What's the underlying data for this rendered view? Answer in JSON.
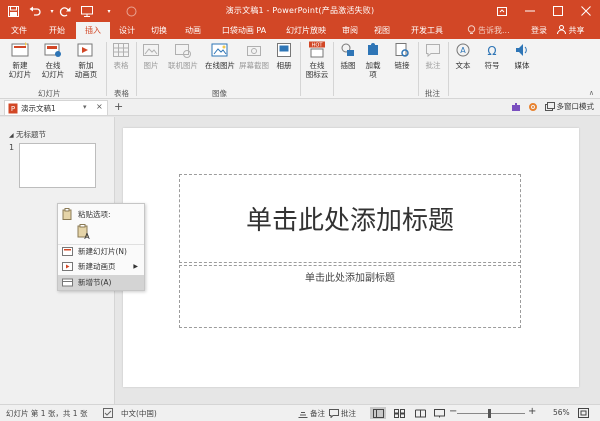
{
  "title_bar": {
    "title": "演示文稿1 - PowerPoint(产品激活失败)",
    "controls": [
      "minimize-icon",
      "maximize-icon",
      "close-icon"
    ]
  },
  "ribbon_tabs": {
    "tabs": [
      "文件",
      "开始",
      "插入",
      "设计",
      "切换",
      "动画",
      "口袋动画 PA",
      "幻灯片放映",
      "审阅",
      "视图",
      "开发工具"
    ],
    "active": "插入",
    "tell_me": "告诉我...",
    "login": "登录",
    "share": "共享"
  },
  "ribbon": {
    "new_slide": "新建\n幻灯片",
    "online_slide": "在线\n幻灯片",
    "new_anim_page": "新加\n动画页",
    "table": "表格",
    "pictures": "图片",
    "online_pictures": "联机图片",
    "online_pics2": "在线图片",
    "screenshot": "屏幕截图",
    "album": "相册",
    "online_icons": "在线\n图标云",
    "illustrations": "插图",
    "addins": "加载\n项",
    "links": "链接",
    "comment": "批注",
    "text": "文本",
    "symbols": "符号",
    "media": "媒体",
    "groups": [
      "幻灯片",
      "表格",
      "图像",
      "批注"
    ],
    "hot_badge": "HOT"
  },
  "doc_tabs": {
    "tab_label": "演示文稿1",
    "more_glyph": "▾",
    "close_glyph": "×",
    "new_tab_glyph": "+",
    "multi_window": "多窗口模式"
  },
  "thumbnail_panel": {
    "section_name": "无标题节",
    "slide_number": "1"
  },
  "slide": {
    "title_placeholder": "单击此处添加标题",
    "subtitle_placeholder": "单击此处添加副标题"
  },
  "context_menu": {
    "paste_options": "粘贴选项:",
    "items": [
      "新建幻灯片(N)",
      "新建动画页",
      "新增节(A)"
    ],
    "highlighted": "新增节(A)"
  },
  "status_bar": {
    "slide_info": "幻灯片 第 1 张，共 1 张",
    "language": "中文(中国)",
    "notes": "备注",
    "comments": "批注",
    "zoom": "56%"
  },
  "colors": {
    "accent": "#d24726",
    "ribbon_bg": "#f3f3f3",
    "workspace_bg": "#e6e6e6"
  }
}
